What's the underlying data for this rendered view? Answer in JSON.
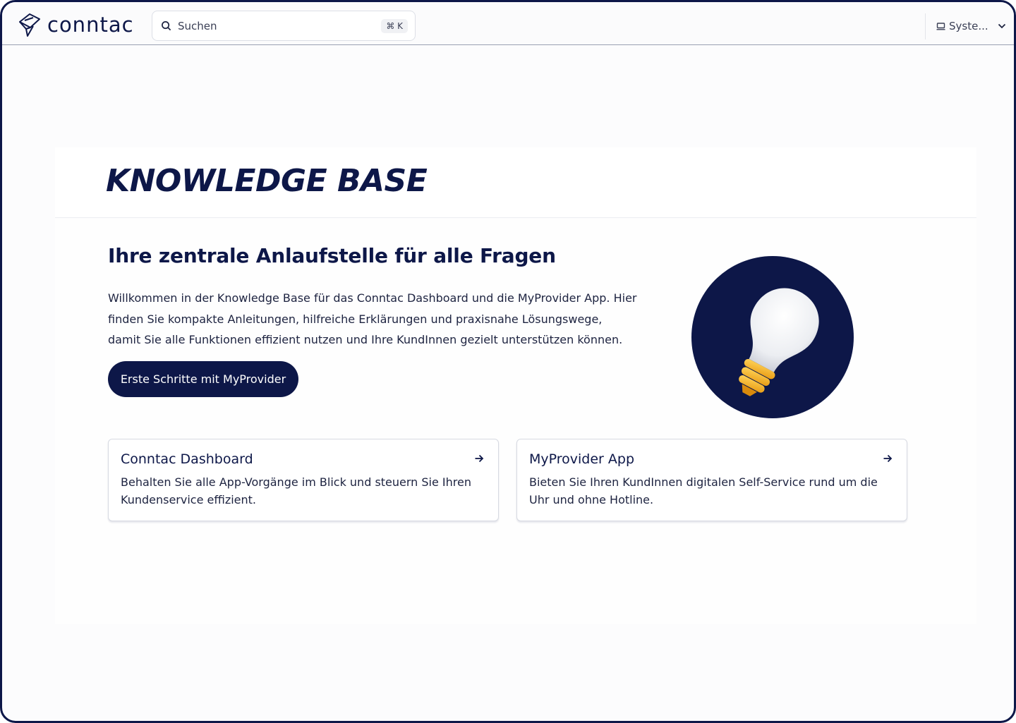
{
  "header": {
    "brand": "conntac",
    "search_placeholder": "Suchen",
    "search_shortcut": "⌘ K",
    "theme_label": "Syste..."
  },
  "hero": {
    "title": "KNOWLEDGE BASE",
    "subtitle": "Ihre zentrale Anlaufstelle für alle Fragen",
    "intro": "Willkommen in der Knowledge Base für das Conntac Dashboard und die MyProvider App. Hier finden Sie kompakte Anleitungen, hilfreiche Erklärungen und praxisnahe Lösungswege, damit Sie alle Funktionen effizient nutzen und Ihre KundInnen gezielt unterstützen können.",
    "cta_label": "Erste Schritte mit MyProvider",
    "illustration_icon": "lightbulb-icon"
  },
  "cards": [
    {
      "title": "Conntac Dashboard",
      "description": "Behalten Sie alle App-Vorgänge im Blick und steuern Sie Ihren Kundenservice effizient."
    },
    {
      "title": "MyProvider App",
      "description": "Bieten Sie Ihren KundInnen digitalen Self-Service rund um die Uhr und ohne Hotline."
    }
  ],
  "colors": {
    "primary": "#0d1748",
    "background": "#fcfcfd",
    "bulb_base": "#f5b82e"
  }
}
